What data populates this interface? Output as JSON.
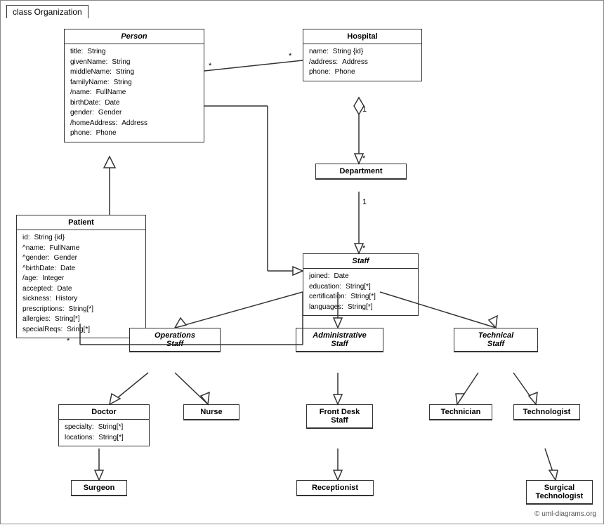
{
  "title": "class Organization",
  "classes": {
    "person": {
      "name": "Person",
      "italic": true,
      "attrs": [
        {
          "name": "title:",
          "type": "String"
        },
        {
          "name": "givenName:",
          "type": "String"
        },
        {
          "name": "middleName:",
          "type": "String"
        },
        {
          "name": "familyName:",
          "type": "String"
        },
        {
          "name": "/name:",
          "type": "FullName"
        },
        {
          "name": "birthDate:",
          "type": "Date"
        },
        {
          "name": "gender:",
          "type": "Gender"
        },
        {
          "name": "/homeAddress:",
          "type": "Address"
        },
        {
          "name": "phone:",
          "type": "Phone"
        }
      ]
    },
    "hospital": {
      "name": "Hospital",
      "italic": false,
      "attrs": [
        {
          "name": "name:",
          "type": "String {id}"
        },
        {
          "name": "/address:",
          "type": "Address"
        },
        {
          "name": "phone:",
          "type": "Phone"
        }
      ]
    },
    "patient": {
      "name": "Patient",
      "italic": false,
      "attrs": [
        {
          "name": "id:",
          "type": "String {id}"
        },
        {
          "name": "^name:",
          "type": "FullName"
        },
        {
          "name": "^gender:",
          "type": "Gender"
        },
        {
          "name": "^birthDate:",
          "type": "Date"
        },
        {
          "name": "/age:",
          "type": "Integer"
        },
        {
          "name": "accepted:",
          "type": "Date"
        },
        {
          "name": "sickness:",
          "type": "History"
        },
        {
          "name": "prescriptions:",
          "type": "String[*]"
        },
        {
          "name": "allergies:",
          "type": "String[*]"
        },
        {
          "name": "specialReqs:",
          "type": "Sring[*]"
        }
      ]
    },
    "department": {
      "name": "Department",
      "italic": false
    },
    "staff": {
      "name": "Staff",
      "italic": true,
      "attrs": [
        {
          "name": "joined:",
          "type": "Date"
        },
        {
          "name": "education:",
          "type": "String[*]"
        },
        {
          "name": "certification:",
          "type": "String[*]"
        },
        {
          "name": "languages:",
          "type": "String[*]"
        }
      ]
    },
    "operations_staff": {
      "name": "Operations\nStaff",
      "italic": true
    },
    "administrative_staff": {
      "name": "Administrative\nStaff",
      "italic": true
    },
    "technical_staff": {
      "name": "Technical\nStaff",
      "italic": true
    },
    "doctor": {
      "name": "Doctor",
      "italic": false,
      "attrs": [
        {
          "name": "specialty:",
          "type": "String[*]"
        },
        {
          "name": "locations:",
          "type": "String[*]"
        }
      ]
    },
    "nurse": {
      "name": "Nurse",
      "italic": false
    },
    "front_desk_staff": {
      "name": "Front Desk\nStaff",
      "italic": false
    },
    "technician": {
      "name": "Technician",
      "italic": false
    },
    "technologist": {
      "name": "Technologist",
      "italic": false
    },
    "surgeon": {
      "name": "Surgeon",
      "italic": false
    },
    "receptionist": {
      "name": "Receptionist",
      "italic": false
    },
    "surgical_technologist": {
      "name": "Surgical\nTechnologist",
      "italic": false
    }
  },
  "copyright": "© uml-diagrams.org"
}
